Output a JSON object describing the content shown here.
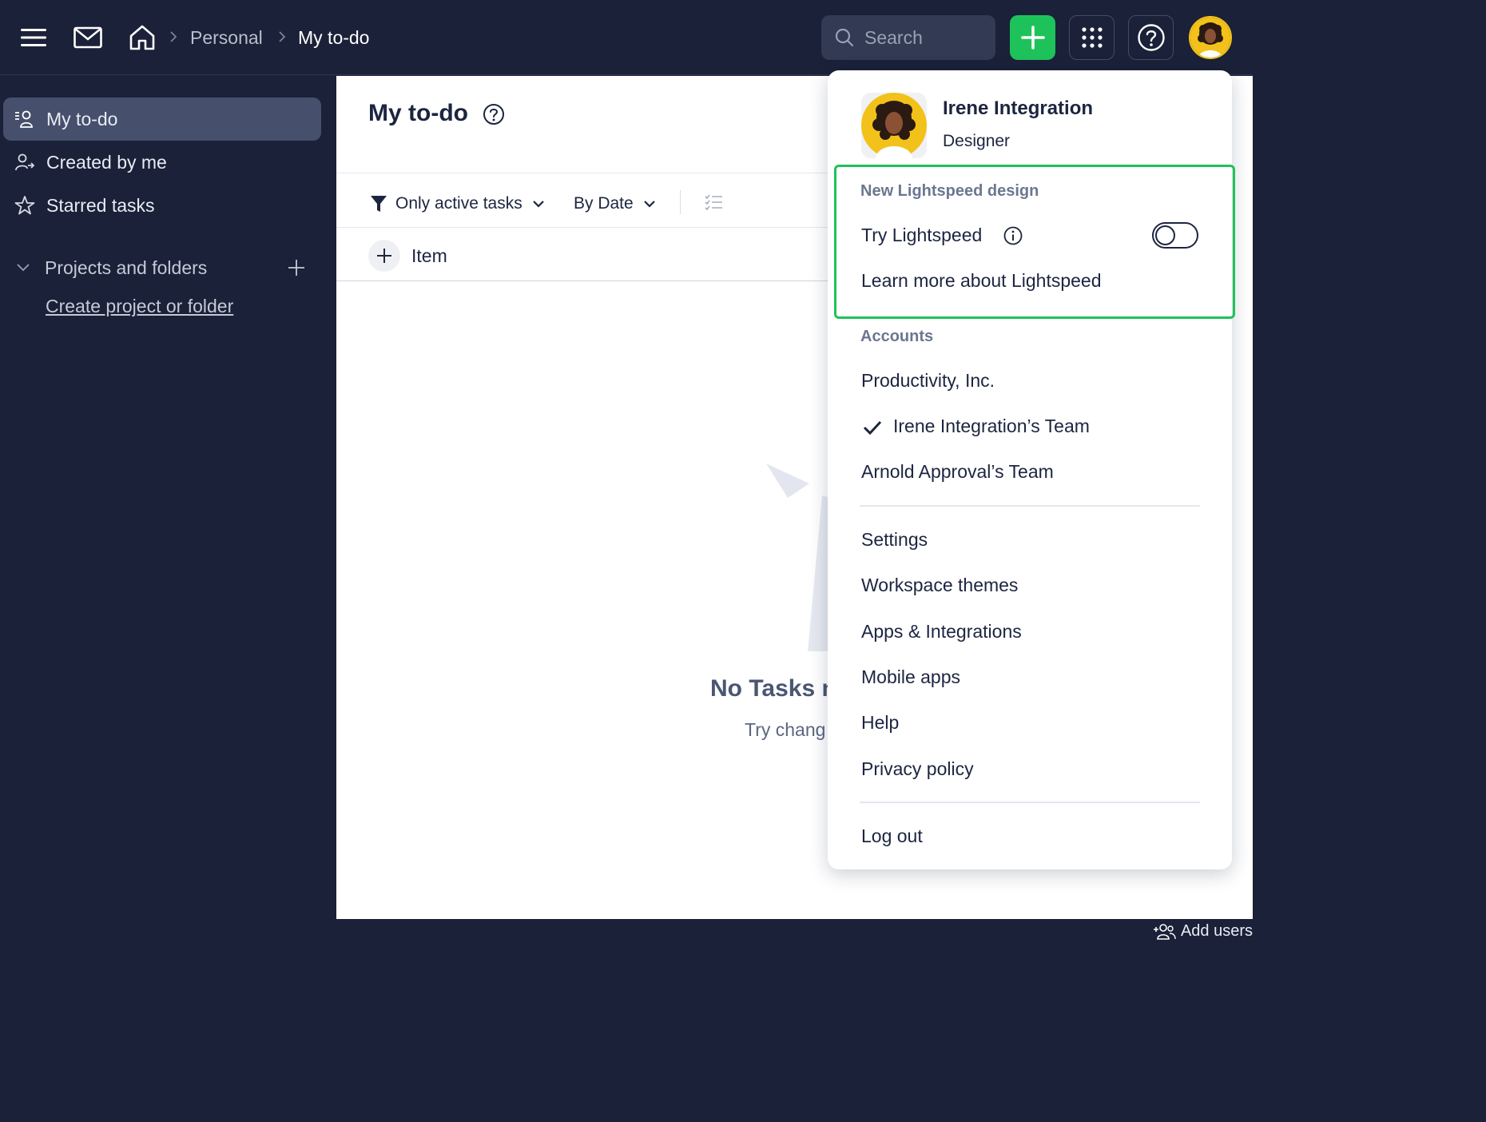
{
  "breadcrumb": {
    "items": [
      "Personal",
      "My to-do"
    ]
  },
  "search": {
    "placeholder": "Search"
  },
  "sidebar": {
    "items": [
      {
        "label": "My to-do",
        "icon": "person-list-icon",
        "active": true
      },
      {
        "label": "Created by me",
        "icon": "person-arrow-icon",
        "active": false
      },
      {
        "label": "Starred tasks",
        "icon": "star-icon",
        "active": false
      }
    ],
    "section_label": "Projects and folders",
    "create_link": "Create project or folder"
  },
  "main": {
    "title": "My to-do",
    "filter_active": "Only active tasks",
    "sort_by": "By Date",
    "add_item_label": "Item",
    "empty_title": "No Tasks n",
    "empty_subtitle": "Try chang"
  },
  "bottombar": {
    "add_users": "Add users"
  },
  "profile_menu": {
    "user_name": "Irene Integration",
    "user_role": "Designer",
    "lightspeed_heading": "New Lightspeed design",
    "try_lightspeed": "Try Lightspeed",
    "lightspeed_enabled": false,
    "learn_more": "Learn more about Lightspeed",
    "accounts_heading": "Accounts",
    "accounts": [
      {
        "name": "Productivity, Inc.",
        "selected": false
      },
      {
        "name": "Irene Integration’s Team",
        "selected": true
      },
      {
        "name": "Arnold Approval’s Team",
        "selected": false
      }
    ],
    "items": [
      "Settings",
      "Workspace themes",
      "Apps & Integrations",
      "Mobile apps",
      "Help",
      "Privacy policy"
    ],
    "logout": "Log out"
  },
  "colors": {
    "topbar_bg": "#1a2138",
    "accent_green": "#1ec25a",
    "sidebar_active": "#46506c"
  }
}
